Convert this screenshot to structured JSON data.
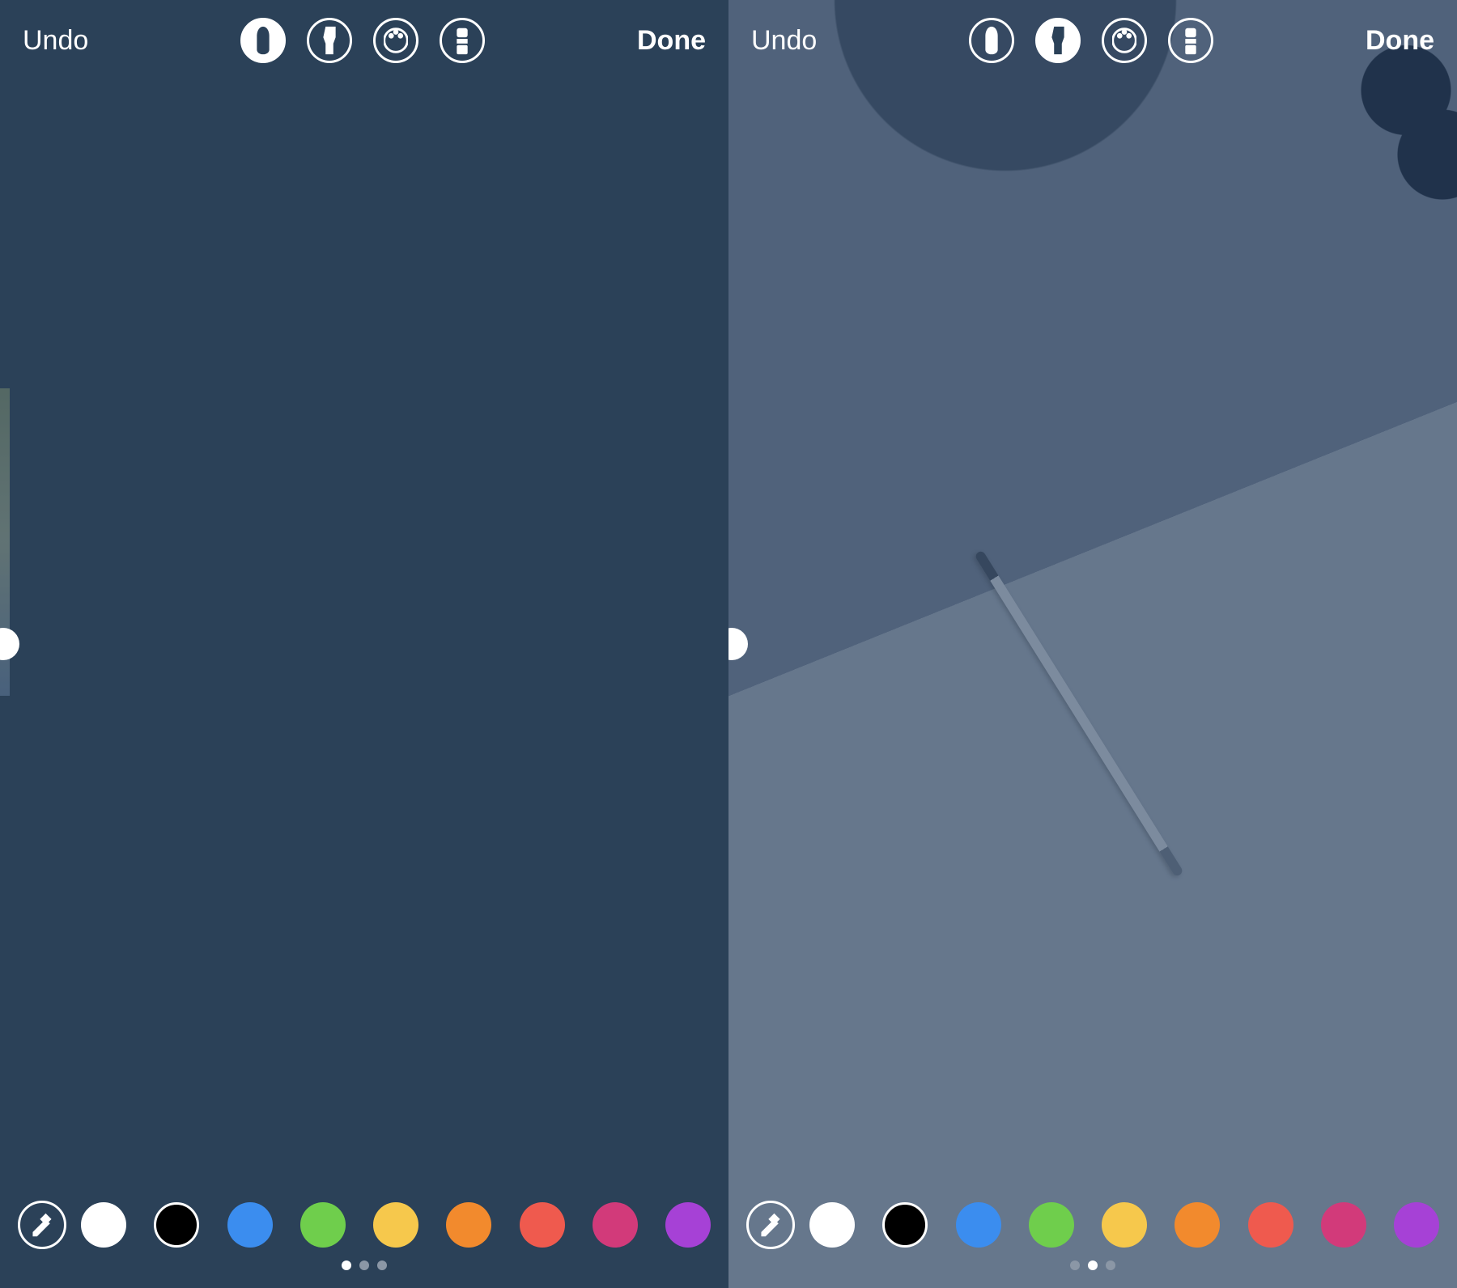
{
  "header": {
    "undo_label": "Undo",
    "done_label": "Done",
    "tools": [
      {
        "id": "pen",
        "name": "pen-tool-icon"
      },
      {
        "id": "marker",
        "name": "marker-tool-icon"
      },
      {
        "id": "neon",
        "name": "neon-tool-icon"
      },
      {
        "id": "eraser",
        "name": "eraser-tool-icon"
      }
    ]
  },
  "panes": [
    {
      "id": "left",
      "selected_tool": "pen",
      "bg": "solid",
      "active_page": 0
    },
    {
      "id": "right",
      "selected_tool": "marker",
      "bg": "photo",
      "active_page": 1
    }
  ],
  "palette": {
    "eyedropper_name": "eyedropper-icon",
    "swatches": [
      {
        "name": "white",
        "hex": "#ffffff",
        "outlined": false
      },
      {
        "name": "black",
        "hex": "#000000",
        "outlined": true
      },
      {
        "name": "blue",
        "hex": "#3b8def",
        "outlined": false
      },
      {
        "name": "green",
        "hex": "#6fce4c",
        "outlined": false
      },
      {
        "name": "yellow",
        "hex": "#f6c84c",
        "outlined": false
      },
      {
        "name": "orange",
        "hex": "#f28a2d",
        "outlined": false
      },
      {
        "name": "red",
        "hex": "#ef5a4e",
        "outlined": false
      },
      {
        "name": "pink",
        "hex": "#d23a7a",
        "outlined": false
      },
      {
        "name": "purple",
        "hex": "#a641d6",
        "outlined": false
      }
    ],
    "page_count": 3
  },
  "colors": {
    "solid_bg": "#2b4158"
  }
}
